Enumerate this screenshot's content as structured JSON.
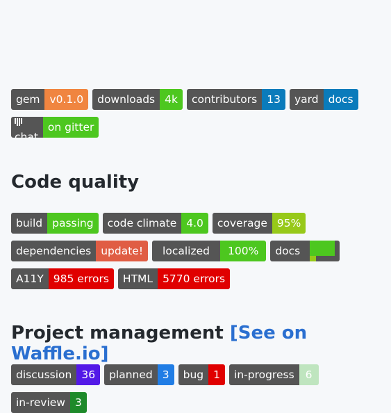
{
  "badges_top": [
    {
      "label": "gem",
      "value": "v0.1.0",
      "color": "#f08540"
    },
    {
      "label": "downloads",
      "value": "4k",
      "color": "#4dc71f"
    },
    {
      "label": "contributors",
      "value": "13",
      "color": "#0a7bbb"
    },
    {
      "label": "yard",
      "value": "docs",
      "color": "#0a7bbb"
    }
  ],
  "gitter": {
    "label": "chat",
    "value": "on gitter",
    "color": "#4dc71f",
    "icon": "gitter-icon"
  },
  "code_quality": {
    "heading": "Code quality",
    "row1": [
      {
        "label": "build",
        "value": "passing",
        "color": "#4dc71f"
      },
      {
        "label": "code climate",
        "value": "4.0",
        "color": "#4dc71f"
      },
      {
        "label": "coverage",
        "value": "95%",
        "color": "#97c919"
      }
    ],
    "row2": [
      {
        "label": "dependencies",
        "value": "update!",
        "color": "#e05d44"
      },
      {
        "label": "localized",
        "value": "100%",
        "color": "#4dc71f"
      }
    ],
    "docs_badge": {
      "label": "docs",
      "segments": [
        {
          "color": "#4dc71f",
          "fraction": 0.6
        },
        {
          "color": "#97c919",
          "fraction": 0.15
        },
        {
          "color": "#8e6bb8",
          "fraction": 0.25
        }
      ]
    },
    "row3": [
      {
        "label": "A11Y",
        "value": "985 errors",
        "color": "#e00000"
      },
      {
        "label": "HTML",
        "value": "5770 errors",
        "color": "#e00000"
      }
    ]
  },
  "project_management": {
    "heading": "Project management",
    "link": "[See on Waffle.io]",
    "row1": [
      {
        "label": "discussion",
        "value": "36",
        "color": "#5319e7"
      },
      {
        "label": "planned",
        "value": "3",
        "color": "#207de5"
      },
      {
        "label": "bug",
        "value": "1",
        "color": "#e00000"
      },
      {
        "label": "in-progress",
        "value": "6",
        "color": "#bfe5bf"
      }
    ],
    "row2": [
      {
        "label": "in-review",
        "value": "3",
        "color": "#1e8a2a"
      }
    ]
  }
}
